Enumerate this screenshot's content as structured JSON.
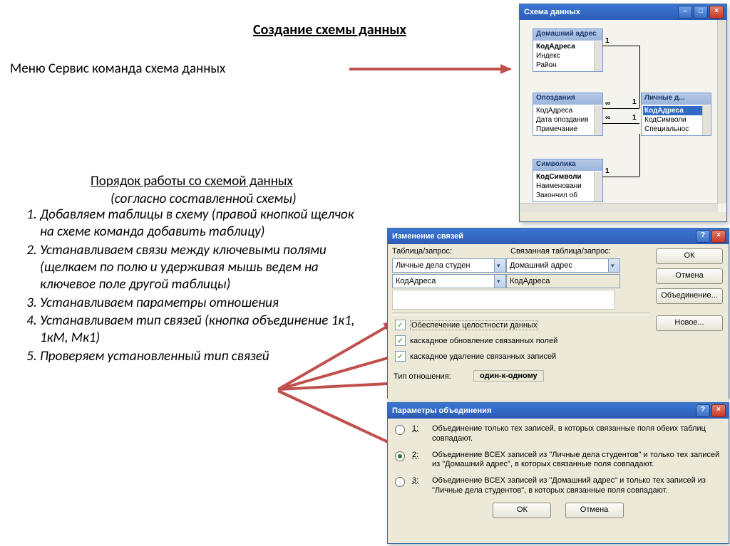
{
  "title": "Создание схемы данных",
  "menu_text": "Меню Сервис команда схема данных",
  "subheading": "Порядок работы со схемой данных",
  "subheading_italic": "(согласно составленной схемы)",
  "steps": [
    "Добавляем таблицы в схему (правой кнопкой щелчок на схеме команда добавить таблицу)",
    " Устанавливаем связи между ключевыми полями (щелкаем по полю и удерживая мышь ведем на ключевое поле другой таблицы)",
    "Устанавливаем параметры отношения",
    "Устанавливаем тип связей (кнопка объединение 1к1, 1кМ, Мк1)",
    "Проверяем установленный тип связей"
  ],
  "schema_window": {
    "title": "Схема данных",
    "tables": {
      "home_address": {
        "title": "Домашний адрес",
        "fields": [
          "КодАдреса",
          "Индекс",
          "Район"
        ]
      },
      "lateness": {
        "title": "Опоздания",
        "fields": [
          "КодАдреса",
          "Дата опоздания",
          "Примечание"
        ]
      },
      "personal": {
        "title": "Личные д...",
        "fields": [
          "КодАдреса",
          "КодСимволи",
          "Специальнос"
        ]
      },
      "symbols": {
        "title": "Символика",
        "fields": [
          "КодСимволи",
          "Наименовани",
          "Закончил об"
        ]
      }
    },
    "rel_marks": {
      "one": "1",
      "inf": "∞"
    }
  },
  "rel_window": {
    "title": "Изменение связей",
    "label_table": "Таблица/запрос:",
    "label_related": "Связанная таблица/запрос:",
    "table_value": "Личные дела студен",
    "related_value": "Домашний адрес",
    "field_left": "КодАдреса",
    "field_right": "КодАдреса",
    "chk1": "Обеспечение целостности данных",
    "chk2": "каскадное обновление связанных полей",
    "chk3": "каскадное удаление связанных записей",
    "type_label": "Тип отношения:",
    "type_value": "один-к-одному",
    "btn_ok": "ОК",
    "btn_cancel": "Отмена",
    "btn_join": "Объединение...",
    "btn_new": "Новое..."
  },
  "join_window": {
    "title": "Параметры объединения",
    "opt_nums": [
      "1:",
      "2:",
      "3:"
    ],
    "opt1": "Объединение только тех записей, в которых связанные поля обеих таблиц совпадают.",
    "opt2": "Объединение ВСЕХ записей из \"Личные дела студентов\" и только тех записей из \"Домашний адрес\", в которых связанные поля совпадают.",
    "opt3": "Объединение ВСЕХ записей из \"Домашний адрес\" и только тех записей из \"Личные дела студентов\", в которых связанные поля совпадают.",
    "btn_ok": "ОК",
    "btn_cancel": "Отмена"
  }
}
